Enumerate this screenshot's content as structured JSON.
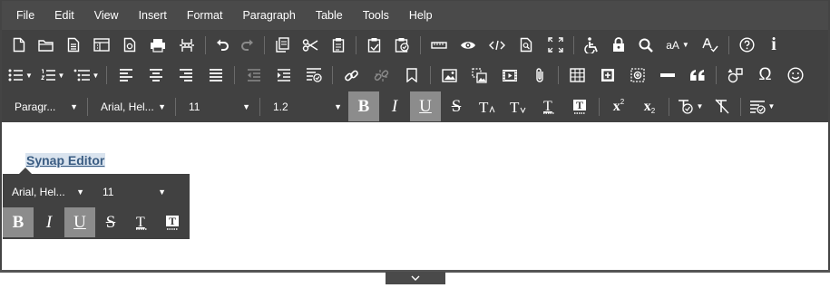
{
  "menubar": {
    "items": [
      "File",
      "Edit",
      "View",
      "Insert",
      "Format",
      "Paragraph",
      "Table",
      "Tools",
      "Help"
    ]
  },
  "toolbar_row1": {
    "icons": [
      "new-document",
      "open-folder",
      "document-properties",
      "template",
      "page-settings",
      "print",
      "page-break",
      "undo",
      "redo",
      "copy",
      "cut",
      "paste",
      "paste-as-text",
      "paste-special",
      "ruler",
      "preview",
      "source-code",
      "find-replace",
      "fullscreen",
      "accessibility",
      "protect-lock",
      "search",
      "font-size-change",
      "spell-check",
      "help",
      "about-info"
    ],
    "font_size_change_label": "aA",
    "info_label": "i"
  },
  "toolbar_row2": {
    "icons": [
      "bullet-list",
      "numbered-list",
      "multilevel-list",
      "align-left",
      "align-center",
      "align-right",
      "justify",
      "outdent",
      "indent",
      "paragraph-format",
      "link",
      "unlink",
      "bookmark",
      "image",
      "image-map",
      "video",
      "attachment",
      "table",
      "insert-div",
      "insert-layer",
      "horizontal-rule",
      "quote",
      "shapes",
      "special-character",
      "emoji"
    ],
    "special_char_glyph": "Ω"
  },
  "toolbar_row3": {
    "paragraph_style": "Paragr...",
    "font_family": "Arial, Hel...",
    "font_size": "11",
    "line_height": "1.2",
    "bold": "B",
    "italic": "I",
    "underline": "U",
    "strike": "S",
    "superscript_label": "x",
    "subscript_label": "x"
  },
  "document": {
    "link_text": "Synap Editor"
  },
  "floating_toolbar": {
    "font_family": "Arial, Hel...",
    "font_size": "11",
    "bold": "B",
    "italic": "I",
    "underline": "U",
    "strike": "S"
  },
  "colors": {
    "toolbar_bg": "#414141",
    "menubar_bg": "#4a4a4a",
    "active_button_bg": "#8c8c8c",
    "link_color": "#3a5c82",
    "link_highlight": "#d9e3ee"
  }
}
